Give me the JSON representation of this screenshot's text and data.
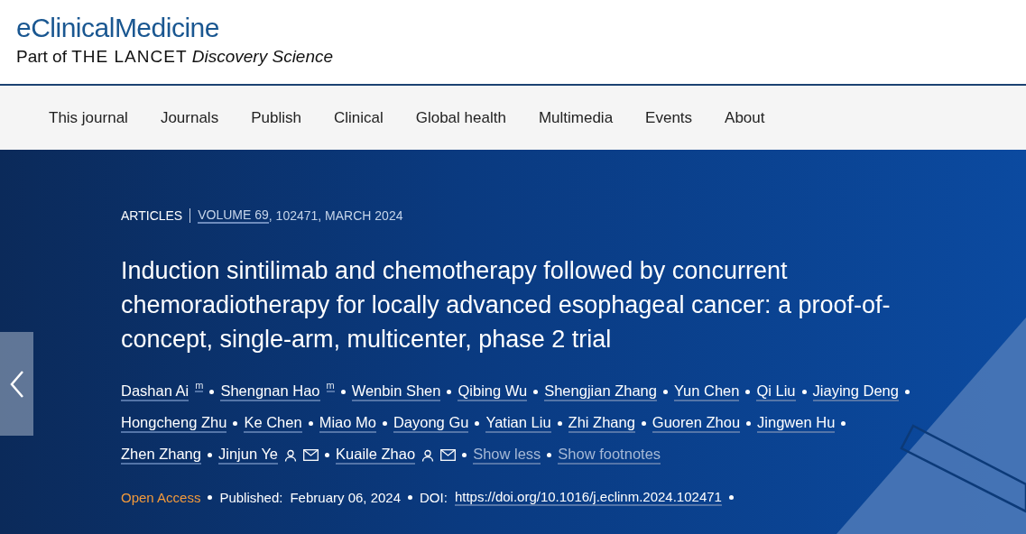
{
  "header": {
    "journal": "eClinicalMedicine",
    "tagline_prefix": "Part of",
    "tagline_brand": "THE LANCET",
    "tagline_suffix": "Discovery Science"
  },
  "nav": [
    "This journal",
    "Journals",
    "Publish",
    "Clinical",
    "Global health",
    "Multimedia",
    "Events",
    "About"
  ],
  "article": {
    "type": "ARTICLES",
    "volume": "VOLUME 69",
    "details": ", 102471, MARCH 2024",
    "title": "Induction sintilimab and chemotherapy followed by concurrent chemoradiotherapy for locally advanced esophageal cancer: a proof-of-concept, single-arm, multicenter, phase 2 trial",
    "author_lines": [
      [
        {
          "name": "Dashan Ai",
          "mark": "m"
        },
        {
          "name": "Shengnan Hao",
          "mark": "m"
        },
        {
          "name": "Wenbin Shen"
        },
        {
          "name": "Qibing Wu"
        },
        {
          "name": "Shengjian Zhang"
        },
        {
          "name": "Yun Chen"
        },
        {
          "name": "Qi Liu"
        },
        {
          "name": "Jiaying Deng"
        }
      ],
      [
        {
          "name": "Hongcheng Zhu"
        },
        {
          "name": "Ke Chen"
        },
        {
          "name": "Miao Mo"
        },
        {
          "name": "Dayong Gu"
        },
        {
          "name": "Yatian Liu"
        },
        {
          "name": "Zhi Zhang"
        },
        {
          "name": "Guoren Zhou"
        },
        {
          "name": "Jingwen Hu"
        }
      ],
      [
        {
          "name": "Zhen Zhang"
        },
        {
          "name": "Jinjun Ye",
          "corresponding": true
        },
        {
          "name": "Kuaile Zhao",
          "corresponding": true
        }
      ]
    ],
    "toggles": [
      "Show less",
      "Show footnotes"
    ],
    "access": "Open Access",
    "published_label": "Published:",
    "published_date": "February 06, 2024",
    "doi_label": "DOI:",
    "doi": "https://doi.org/10.1016/j.eclinm.2024.102471"
  }
}
